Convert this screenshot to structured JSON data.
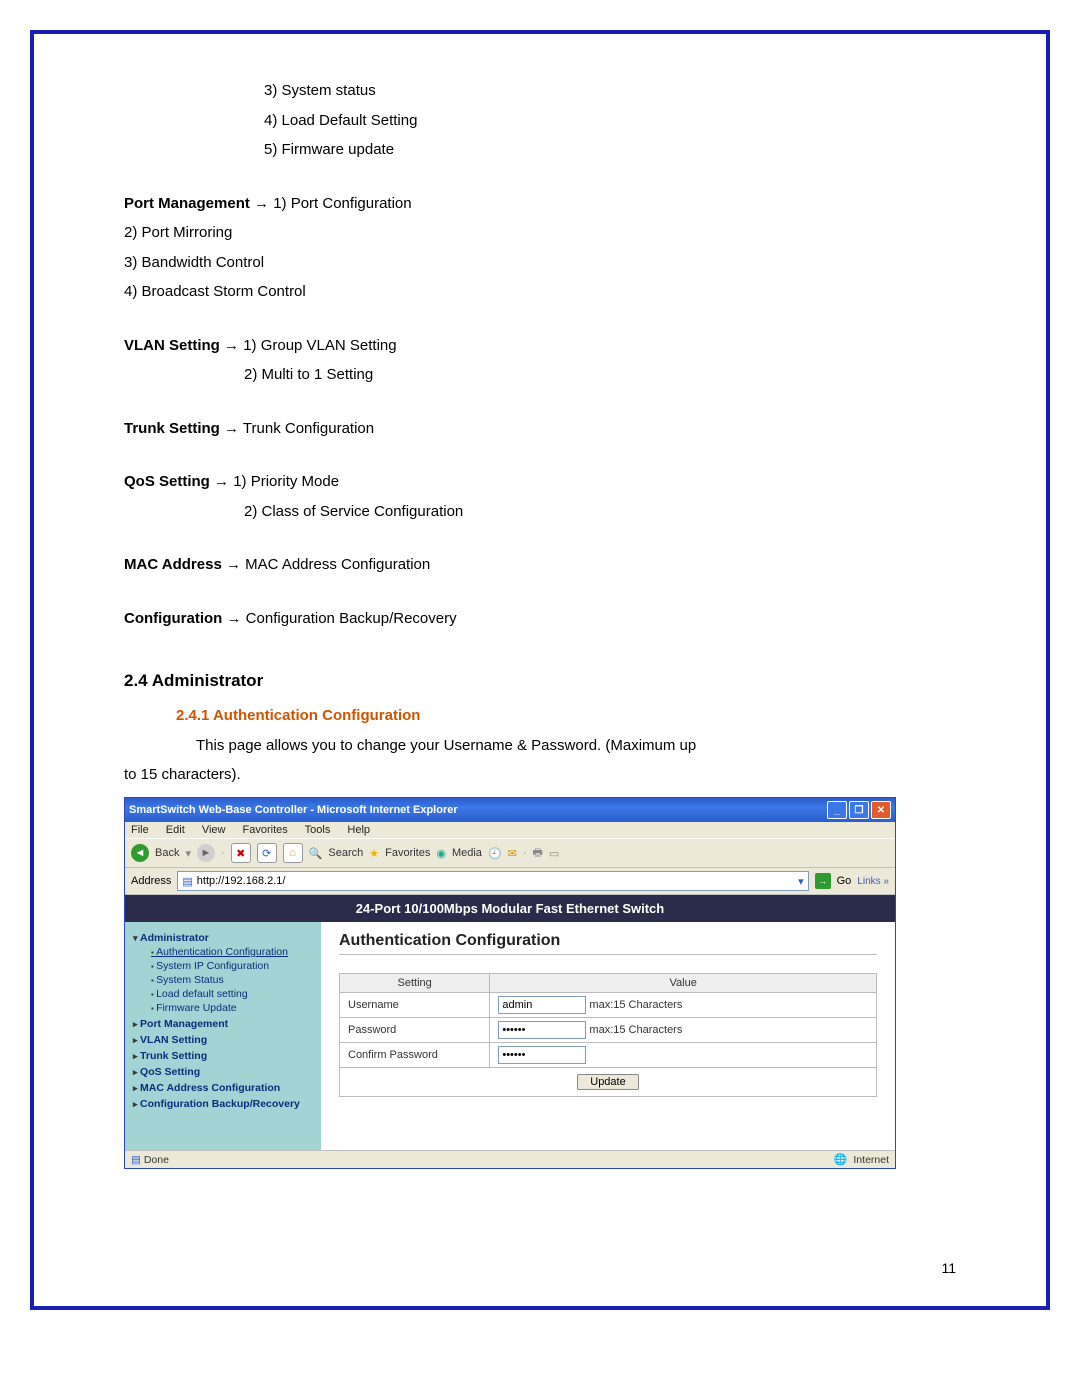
{
  "sys_items": {
    "i3": "3) System status",
    "i4": "4) Load Default Setting",
    "i5": "5) Firmware update"
  },
  "port_mgmt": {
    "label": "Port Management",
    "arrow": "→",
    "i1": "1) Port Configuration",
    "i2": "2) Port Mirroring",
    "i3": "3) Bandwidth Control",
    "i4": "4) Broadcast Storm Control"
  },
  "vlan": {
    "label": "VLAN Setting",
    "i1": "1) Group VLAN Setting",
    "i2": "2) Multi to 1 Setting"
  },
  "trunk": {
    "label": "Trunk Setting",
    "i1": "Trunk Configuration"
  },
  "qos": {
    "label": "QoS Setting",
    "i1": "1) Priority Mode",
    "i2": "2) Class of Service Configuration"
  },
  "mac": {
    "label": "MAC Address",
    "i1": "MAC Address Configuration"
  },
  "config": {
    "label": "Configuration",
    "i1": "Configuration Backup/Recovery"
  },
  "h3": "2.4 Administrator",
  "h4": "2.4.1 Authentication Configuration",
  "body1": "This page allows you to change your Username & Password. (Maximum up",
  "body2": "to 15 characters).",
  "page_number": "11",
  "ie": {
    "title": "SmartSwitch Web-Base Controller - Microsoft Internet Explorer",
    "menu": {
      "file": "File",
      "edit": "Edit",
      "view": "View",
      "fav": "Favorites",
      "tools": "Tools",
      "help": "Help"
    },
    "toolbar": {
      "back": "Back",
      "search": "Search",
      "favorites": "Favorites",
      "media": "Media"
    },
    "address_label": "Address",
    "address_url": "http://192.168.2.1/",
    "go": "Go",
    "links": "Links »",
    "banner": "24-Port 10/100Mbps Modular Fast Ethernet Switch",
    "sidebar": {
      "admin": "Administrator",
      "auth": "Authentication Configuration",
      "sysip": "System IP Configuration",
      "sysstat": "System Status",
      "loaddef": "Load default setting",
      "fw": "Firmware Update",
      "port": "Port Management",
      "vlan": "VLAN Setting",
      "trunk": "Trunk Setting",
      "qos": "QoS Setting",
      "mac": "MAC Address Configuration",
      "cfg": "Configuration Backup/Recovery"
    },
    "main": {
      "heading": "Authentication Configuration",
      "col_setting": "Setting",
      "col_value": "Value",
      "row_user": "Username",
      "row_pass": "Password",
      "row_cpass": "Confirm Password",
      "user_val": "admin",
      "pass_val": "••••••",
      "hint": "max:15 Characters",
      "update": "Update"
    },
    "status_done": "Done",
    "status_zone": "Internet"
  }
}
